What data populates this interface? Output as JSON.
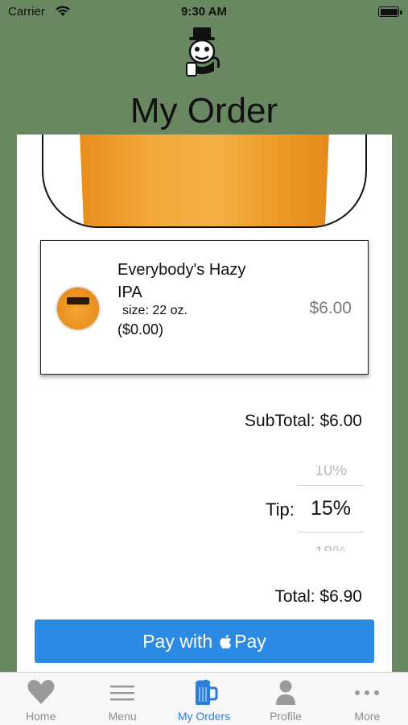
{
  "status_bar": {
    "carrier": "Carrier",
    "time": "9:30 AM"
  },
  "header": {
    "title": "My Order",
    "logo_icon": "brewery-mascot-logo"
  },
  "order_item": {
    "name": "Everybody's Hazy IPA",
    "size": "size: 22 oz.",
    "extra": "($0.00)",
    "price": "$6.00"
  },
  "summary": {
    "subtotal": "SubTotal: $6.00",
    "tip_label": "Tip:",
    "tip_options": [
      "10%",
      "15%",
      "18%"
    ],
    "tip_selected": "15%",
    "total": "Total: $6.90"
  },
  "pay_button": {
    "label_prefix": "Pay with",
    "label_suffix": "Pay",
    "icon": "apple-icon"
  },
  "tab_bar": {
    "items": [
      {
        "label": "Home",
        "icon": "heart-icon"
      },
      {
        "label": "Menu",
        "icon": "menu-lines-icon"
      },
      {
        "label": "My Orders",
        "icon": "beer-mug-icon"
      },
      {
        "label": "Profile",
        "icon": "person-icon"
      },
      {
        "label": "More",
        "icon": "more-dots-icon"
      }
    ],
    "active_index": 2
  },
  "colors": {
    "background": "#698861",
    "pay_button": "#2b8be4",
    "active_tab": "#2b7fd9",
    "inactive_tab": "#8e8e8e"
  }
}
